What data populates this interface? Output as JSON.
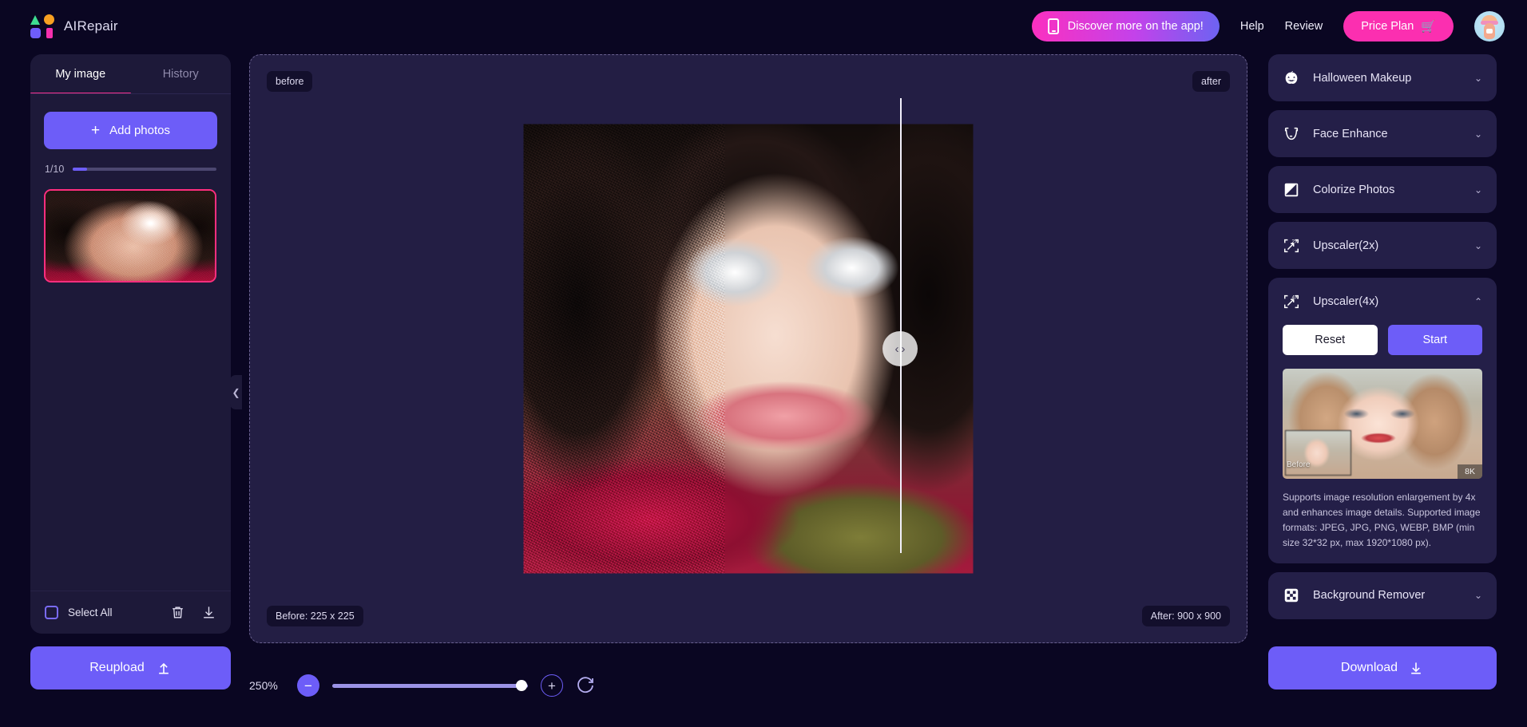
{
  "app": {
    "name": "AIRepair",
    "logo_colors": [
      "#3ddc91",
      "#f7a021",
      "#6f5dfb",
      "#f52fae"
    ]
  },
  "topbar": {
    "discover_label": "Discover more on the app!",
    "discover_icon": "phone-icon",
    "help_label": "Help",
    "review_label": "Review",
    "price_plan_label": "Price Plan",
    "price_plan_icon": "cart-icon",
    "avatar_icon": "user-avatar"
  },
  "sidebar": {
    "tabs": [
      {
        "label": "My image",
        "active": true
      },
      {
        "label": "History",
        "active": false
      }
    ],
    "add_photos_label": "Add photos",
    "add_photos_icon": "plus-icon",
    "counter_text": "1/10",
    "counter_progress_pct": 10,
    "thumbnail_alt": "selected-photo-thumbnail",
    "select_all_label": "Select All",
    "delete_icon": "trash-icon",
    "download_icon": "download-icon",
    "reupload_label": "Reupload",
    "reupload_icon": "upload-icon"
  },
  "canvas": {
    "before_label": "before",
    "after_label": "after",
    "before_size": "Before: 225 x 225",
    "after_size": "After: 900 x 900",
    "compare_handle_icon": "compare-slider-handle",
    "collapse_icon": "chevron-left-icon"
  },
  "zoom": {
    "value": "250%",
    "minus_icon": "minus-icon",
    "plus_icon": "plus-icon",
    "reset_icon": "reset-rotate-icon",
    "slider_pct": 96
  },
  "features": [
    {
      "label": "Halloween Makeup",
      "icon": "pumpkin-icon",
      "expanded": false
    },
    {
      "label": "Face Enhance",
      "icon": "face-icon",
      "expanded": false
    },
    {
      "label": "Colorize Photos",
      "icon": "colorize-icon",
      "expanded": false
    },
    {
      "label": "Upscaler(2x)",
      "icon": "upscale-2x-icon",
      "expanded": false
    },
    {
      "label": "Upscaler(4x)",
      "icon": "upscale-4x-icon",
      "expanded": true
    },
    {
      "label": "Background Remover",
      "icon": "checkerboard-icon",
      "expanded": false
    }
  ],
  "upscaler4x": {
    "reset_label": "Reset",
    "start_label": "Start",
    "preview_before_label": "Before",
    "preview_quality_label": "8K",
    "description": "Supports image resolution enlargement by 4x and enhances image details. Supported image formats: JPEG, JPG, PNG, WEBP, BMP (min size 32*32 px, max 1920*1080 px)."
  },
  "download_button": {
    "label": "Download",
    "icon": "download-icon"
  },
  "colors": {
    "page_bg": "#0a0622",
    "panel_bg": "#1d1939",
    "card_bg": "#241f48",
    "accent_purple": "#6d5df8",
    "accent_pink": "#f6308f",
    "accent_magenta": "#fb2fb0"
  }
}
